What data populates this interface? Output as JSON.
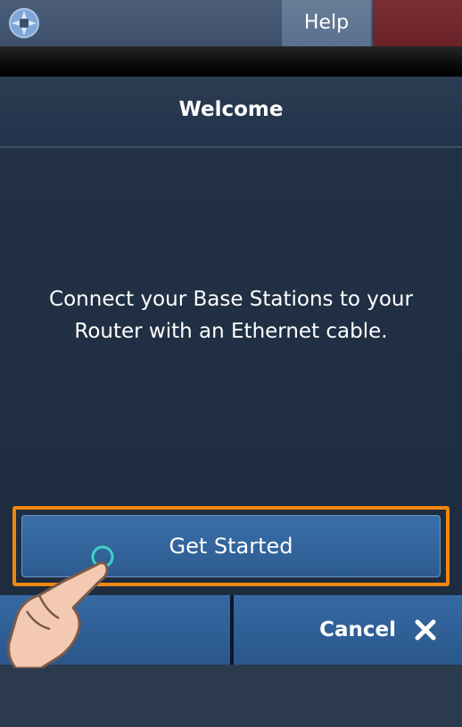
{
  "topbar": {
    "logo_icon": "app-logo-icon",
    "help_label": "Help"
  },
  "header": {
    "title": "Welcome"
  },
  "main": {
    "message": "Connect your Base Stations to your Router with an Ethernet cable."
  },
  "actions": {
    "get_started_label": "Get Started",
    "cancel_label": "Cancel",
    "cancel_icon": "close-icon"
  },
  "colors": {
    "highlight": "#f0870f",
    "button_blue": "#3669a3",
    "background": "#1c2a3d"
  }
}
